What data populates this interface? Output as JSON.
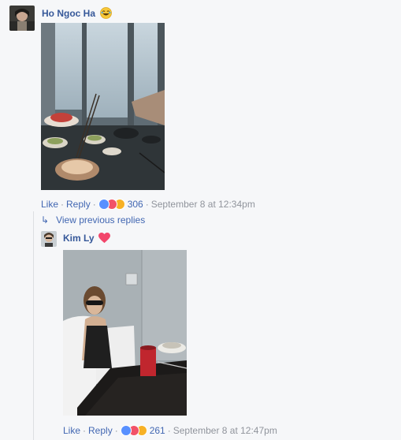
{
  "comment1": {
    "author": "Ho Ngoc Ha",
    "emoji": "laughing-face",
    "actions": {
      "like": "Like",
      "reply": "Reply",
      "reaction_count": "306",
      "timestamp": "September 8 at 12:34pm"
    }
  },
  "view_previous": "View previous replies",
  "comment2": {
    "author": "Kim Ly",
    "emoji": "red-heart",
    "actions": {
      "like": "Like",
      "reply": "Reply",
      "reaction_count": "261",
      "timestamp": "September 8 at 12:47pm"
    }
  },
  "colors": {
    "name": "#365899",
    "link": "#4267b2",
    "meta": "#90949c",
    "background": "#f6f7f9",
    "like_reaction": "#5890ff",
    "love_reaction": "#f25268",
    "haha_reaction": "#f7b125"
  },
  "separator": "·"
}
